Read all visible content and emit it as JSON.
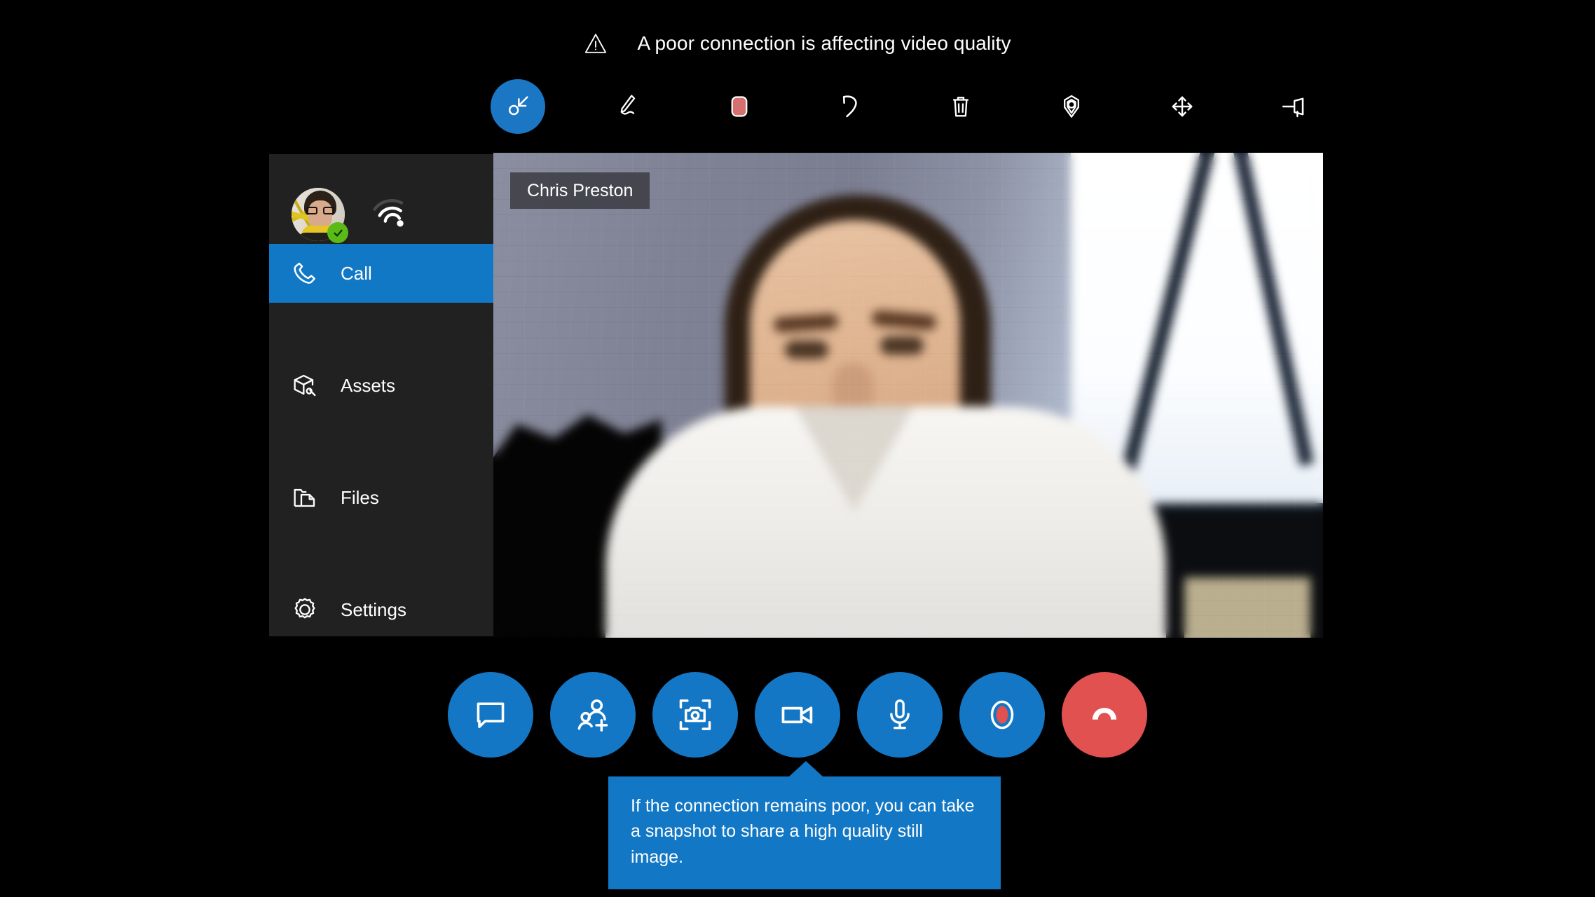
{
  "banner": {
    "icon": "warning-triangle-icon",
    "message": "A poor connection is affecting video quality"
  },
  "toolbar": {
    "items": [
      {
        "name": "select-tool",
        "label": "Select",
        "icon": "cursor-select-icon",
        "active": true
      },
      {
        "name": "ink-tool",
        "label": "Ink",
        "icon": "pen-icon",
        "active": false
      },
      {
        "name": "color-swatch",
        "label": "Color",
        "icon": "color-swatch-icon",
        "active": false,
        "color": "#d4706f"
      },
      {
        "name": "undo-tool",
        "label": "Undo",
        "icon": "undo-arrow-icon",
        "active": false
      },
      {
        "name": "delete-tool",
        "label": "Delete",
        "icon": "trash-icon",
        "active": false
      },
      {
        "name": "place-tool",
        "label": "Place",
        "icon": "location-pin-icon",
        "active": false
      },
      {
        "name": "move-tool",
        "label": "Move",
        "icon": "move-arrows-icon",
        "active": false
      },
      {
        "name": "pin-tool",
        "label": "Pin",
        "icon": "pushpin-icon",
        "active": false
      }
    ]
  },
  "sidebar": {
    "profile": {
      "avatar_name": "avatar",
      "presence": "available",
      "presence_color": "#5bba16",
      "signal_icon": "wifi-signal-icon",
      "signal_strength": "weak"
    },
    "items": [
      {
        "label": "Call",
        "icon": "phone-icon",
        "selected": true
      },
      {
        "label": "Assets",
        "icon": "package-icon",
        "selected": false
      },
      {
        "label": "Files",
        "icon": "folder-icon",
        "selected": false
      },
      {
        "label": "Settings",
        "icon": "gear-icon",
        "selected": false
      }
    ]
  },
  "video": {
    "participant_name": "Chris Preston"
  },
  "call_controls": [
    {
      "name": "chat-button",
      "label": "Chat",
      "icon": "chat-bubble-icon",
      "style": "primary"
    },
    {
      "name": "add-people-button",
      "label": "Add people",
      "icon": "add-person-icon",
      "style": "primary"
    },
    {
      "name": "snapshot-button",
      "label": "Snapshot",
      "icon": "camera-frame-icon",
      "style": "primary"
    },
    {
      "name": "video-button",
      "label": "Video",
      "icon": "video-camera-icon",
      "style": "primary"
    },
    {
      "name": "microphone-button",
      "label": "Microphone",
      "icon": "microphone-icon",
      "style": "primary"
    },
    {
      "name": "record-button",
      "label": "Record",
      "icon": "record-icon",
      "style": "primary"
    },
    {
      "name": "hangup-button",
      "label": "End call",
      "icon": "hangup-phone-icon",
      "style": "danger"
    }
  ],
  "tooltip": {
    "text": "If the connection remains poor, you can take a snapshot to share a high quality still image."
  },
  "colors": {
    "accent": "#1277c5",
    "danger": "#e0514f",
    "panel": "#212121",
    "background": "#000000",
    "presence_green": "#5bba16",
    "swatch_red": "#d4706f"
  }
}
